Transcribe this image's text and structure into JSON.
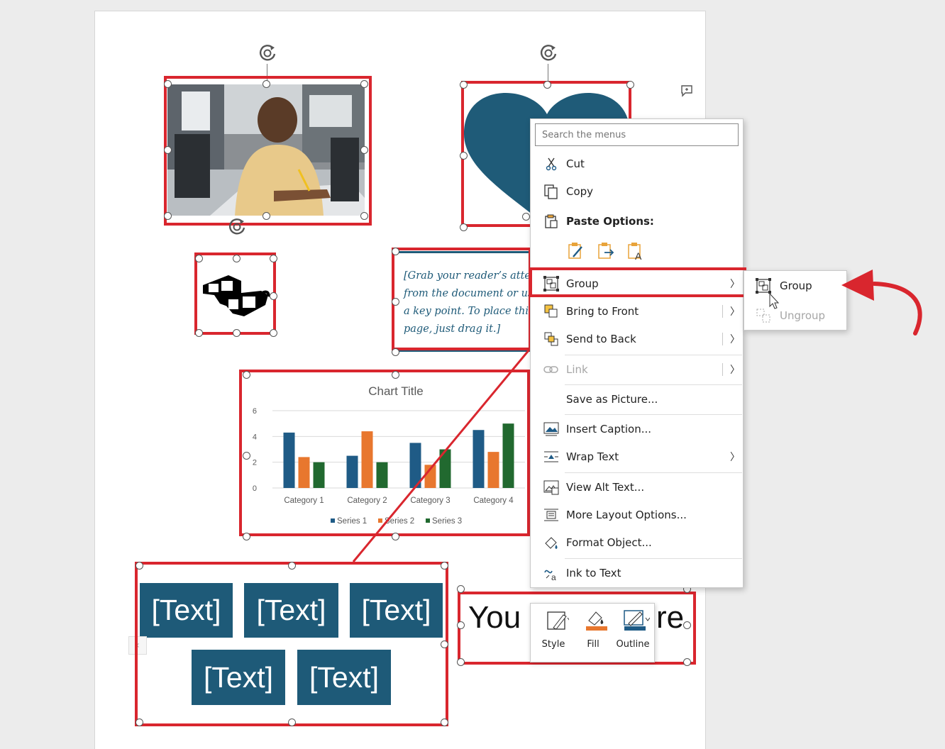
{
  "document": {
    "quote_lines": [
      "[Grab your reader’s atter",
      "from the document or us",
      "a key point. To place this",
      "page, just drag it.]"
    ],
    "wordart_text": "You",
    "wordart_tail": "re",
    "smartart_tiles": [
      "[Text]",
      "[Text]",
      "[Text]",
      "[Text]",
      "[Text]"
    ]
  },
  "chart_data": {
    "type": "bar",
    "title": "Chart Title",
    "categories": [
      "Category 1",
      "Category 2",
      "Category 3",
      "Category 4"
    ],
    "series": [
      {
        "name": "Series 1",
        "color": "#1f5b86",
        "values": [
          4.3,
          2.5,
          3.5,
          4.5
        ]
      },
      {
        "name": "Series 2",
        "color": "#e8772e",
        "values": [
          2.4,
          4.4,
          1.8,
          2.8
        ]
      },
      {
        "name": "Series 3",
        "color": "#21692f",
        "values": [
          2.0,
          2.0,
          3.0,
          5.0
        ]
      }
    ],
    "ylim": [
      0,
      6
    ],
    "yticks": [
      "0",
      "2",
      "4",
      "6"
    ],
    "legend": "bottom",
    "grid": true
  },
  "context_menu": {
    "search_placeholder": "Search the menus",
    "cut": "Cut",
    "copy": "Copy",
    "paste_options": "Paste Options:",
    "group": "Group",
    "bring_to_front": "Bring to Front",
    "send_to_back": "Send to Back",
    "link": "Link",
    "save_as_picture": "Save as Picture...",
    "insert_caption": "Insert Caption...",
    "wrap_text": "Wrap Text",
    "view_alt_text": "View Alt Text...",
    "more_layout_options": "More Layout Options...",
    "format_object": "Format Object...",
    "ink_to_text": "Ink to Text"
  },
  "submenu": {
    "group": "Group",
    "ungroup": "Ungroup"
  },
  "mini_toolbar": {
    "style": "Style",
    "fill": "Fill",
    "outline": "Outline"
  },
  "colors": {
    "selection_red": "#d9262e",
    "accent_teal": "#1e5a78",
    "fill_orange": "#e8772e"
  }
}
